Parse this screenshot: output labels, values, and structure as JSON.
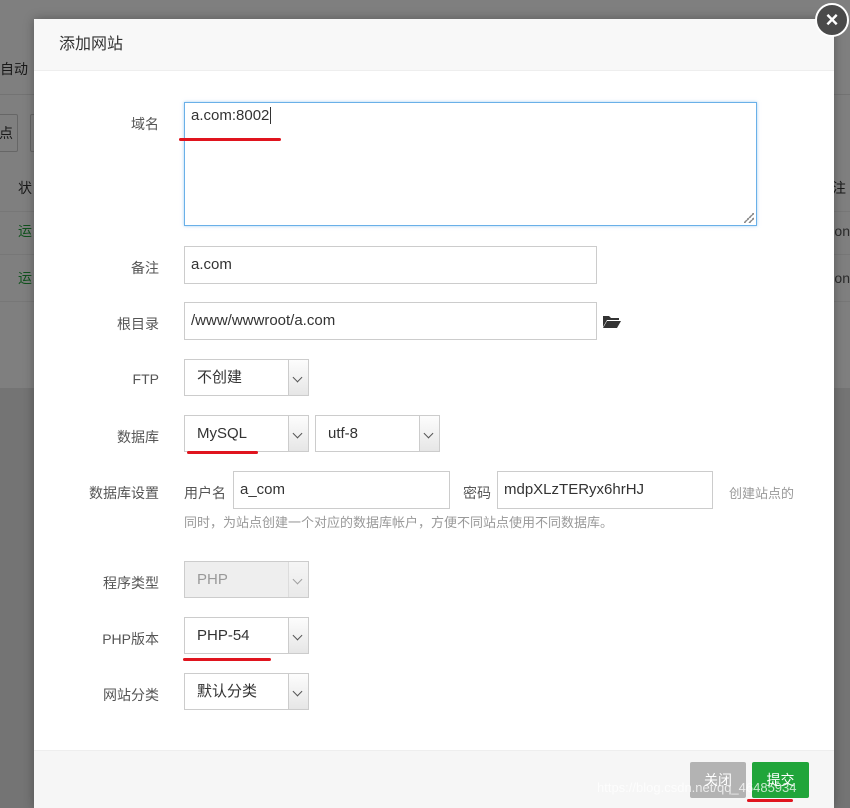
{
  "background": {
    "top_label": "自动",
    "btn_left": "点",
    "col_left_header": "状",
    "col_right_header": "注",
    "rows": [
      {
        "left": "运",
        "right": "on"
      },
      {
        "left": "运",
        "right": "on"
      }
    ]
  },
  "dialog": {
    "title": "添加网站",
    "close_icon": "×",
    "fields": {
      "domain_label": "域名",
      "domain_value": "a.com:8002",
      "remark_label": "备注",
      "remark_value": "a.com",
      "root_label": "根目录",
      "root_value": "/www/wwwroot/a.com",
      "ftp_label": "FTP",
      "ftp_value": "不创建",
      "db_label": "数据库",
      "db_value": "MySQL",
      "db_charset": "utf-8",
      "db_settings_label": "数据库设置",
      "db_user_label": "用户名",
      "db_user_value": "a_com",
      "db_pass_label": "密码",
      "db_pass_value": "mdpXLzTERyx6hrHJ",
      "db_hint_1": "创建站点的",
      "db_hint_2": "同时，为站点创建一个对应的数据库帐户，方便不同站点使用不同数据库。",
      "program_label": "程序类型",
      "program_value": "PHP",
      "php_label": "PHP版本",
      "php_value": "PHP-54",
      "category_label": "网站分类",
      "category_value": "默认分类"
    },
    "footer": {
      "close_label": "关闭",
      "submit_label": "提交"
    }
  },
  "watermark": "https://blog.csdn.net/qq_46485934",
  "colors": {
    "accent_green": "#20a53a",
    "annotation_red": "#e0141e",
    "focus_blue": "#6ab0e8"
  },
  "icons": {
    "folder": "folder-open-icon",
    "close": "close-icon"
  }
}
